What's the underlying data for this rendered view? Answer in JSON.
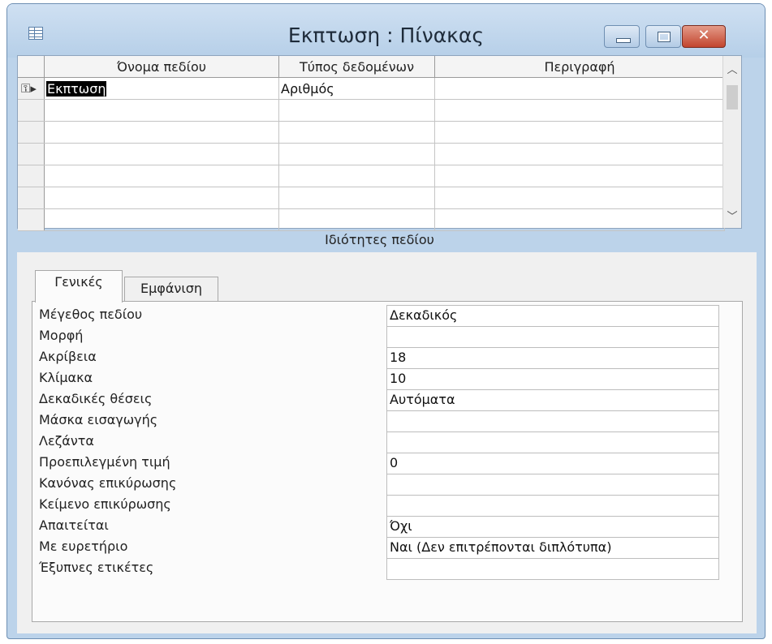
{
  "window": {
    "title": "Εκπτωση : Πίνακας",
    "close_glyph": "✕"
  },
  "grid": {
    "columns": [
      "Όνομα πεδίου",
      "Τύπος δεδομένων",
      "Περιγραφή"
    ],
    "rows": [
      {
        "name": "Εκπτωση",
        "type": "Αριθμός",
        "description": ""
      },
      {
        "name": "",
        "type": "",
        "description": ""
      },
      {
        "name": "",
        "type": "",
        "description": ""
      },
      {
        "name": "",
        "type": "",
        "description": ""
      },
      {
        "name": "",
        "type": "",
        "description": ""
      },
      {
        "name": "",
        "type": "",
        "description": ""
      },
      {
        "name": "",
        "type": "",
        "description": ""
      }
    ],
    "row_selector_glyph": "⚿▸",
    "scroll_up_glyph": "︿",
    "scroll_down_glyph": "﹀"
  },
  "properties": {
    "header": "Ιδιότητες πεδίου",
    "tabs": [
      "Γενικές",
      "Εμφάνιση"
    ],
    "rows": [
      {
        "label": "Μέγεθος πεδίου",
        "value": "Δεκαδικός"
      },
      {
        "label": "Μορφή",
        "value": ""
      },
      {
        "label": "Ακρίβεια",
        "value": "18"
      },
      {
        "label": "Κλίμακα",
        "value": "10"
      },
      {
        "label": "Δεκαδικές θέσεις",
        "value": "Αυτόματα"
      },
      {
        "label": "Μάσκα εισαγωγής",
        "value": ""
      },
      {
        "label": "Λεζάντα",
        "value": ""
      },
      {
        "label": "Προεπιλεγμένη τιμή",
        "value": "0"
      },
      {
        "label": "Κανόνας επικύρωσης",
        "value": ""
      },
      {
        "label": "Κείμενο επικύρωσης",
        "value": ""
      },
      {
        "label": "Απαιτείται",
        "value": "Όχι"
      },
      {
        "label": "Με ευρετήριο",
        "value": "Ναι (Δεν επιτρέπονται διπλότυπα)"
      },
      {
        "label": "Έξυπνες ετικέτες",
        "value": ""
      }
    ]
  }
}
